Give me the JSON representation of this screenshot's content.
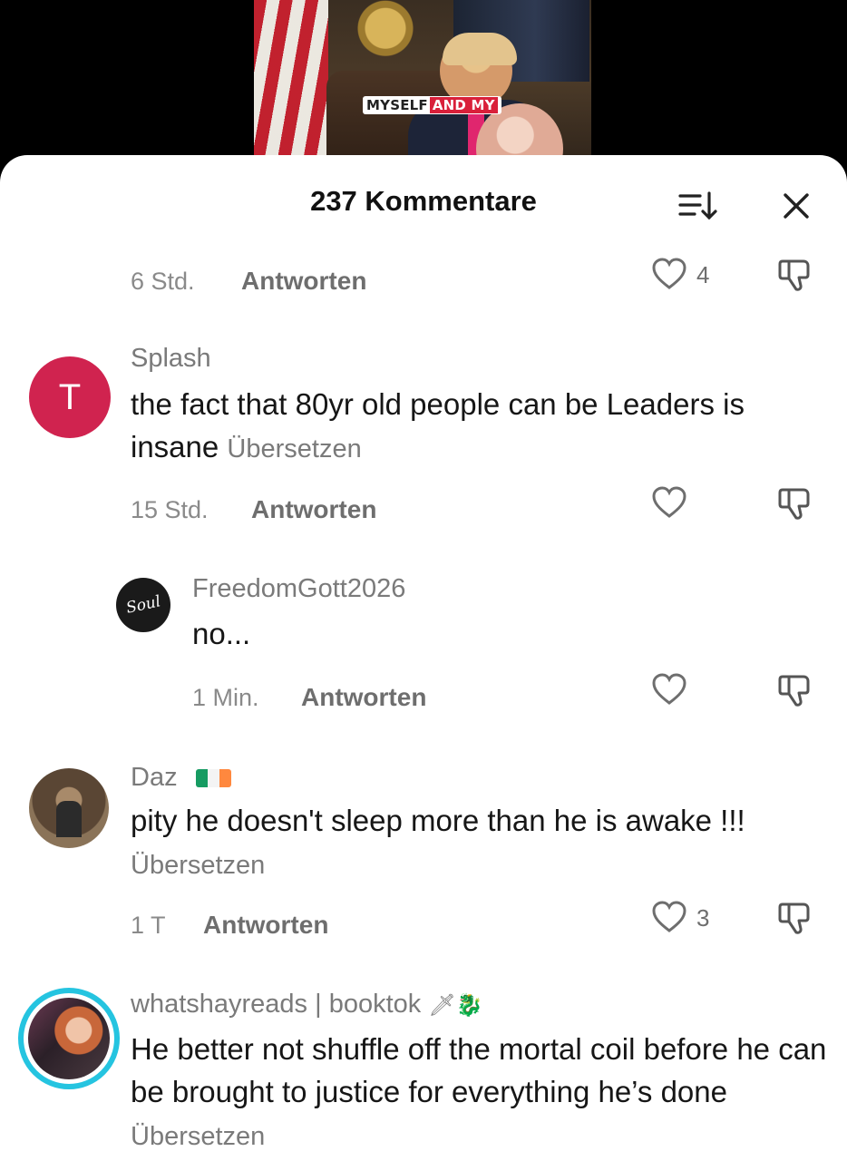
{
  "video": {
    "caption_words": [
      "MYSELF",
      "AND MY"
    ]
  },
  "header": {
    "title": "237 Kommentare",
    "sort_icon": "sort-icon",
    "close_icon": "close-icon"
  },
  "reply_label": "Antworten",
  "translate_label": "Übersetzen",
  "comments": [
    {
      "time": "6 Std.",
      "likes": "4"
    },
    {
      "username": "Splash",
      "avatar_letter": "T",
      "avatar_color": "#d0234f",
      "text": "the fact that 80yr old people can be Leaders is insane",
      "time": "15 Std.",
      "likes": ""
    },
    {
      "username": "FreedomGott2026",
      "avatar_text": "Soul",
      "avatar_color": "#1a1a1a",
      "text": "no...",
      "time": "1 Min.",
      "likes": ""
    },
    {
      "username": "Daz",
      "flag_colors": [
        "#169b62",
        "#ffffff",
        "#ff883e"
      ],
      "text": "pity he doesn't sleep more than he is awake !!!",
      "time": "1 T",
      "likes": "3"
    },
    {
      "username": "whatshayreads | booktok",
      "username_emoji": "🗡🐉",
      "avatar_ring_color": "#25c4e0",
      "text": "He better not shuffle off the mortal coil before he can be brought to justice for everything he’s done"
    }
  ]
}
